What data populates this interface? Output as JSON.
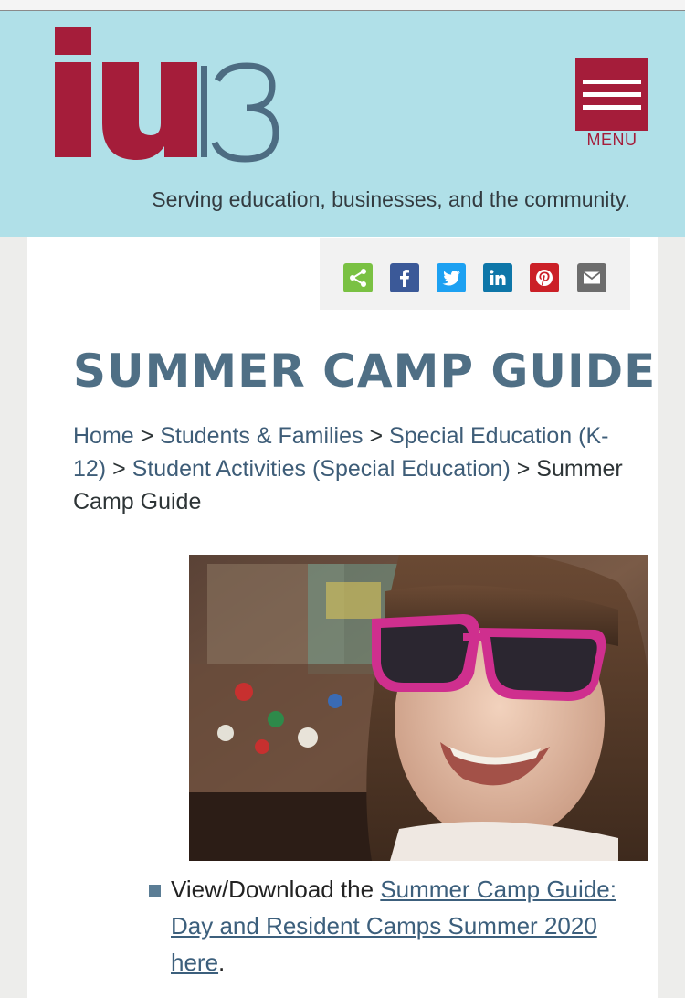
{
  "header": {
    "logo_text": "iu13",
    "menu_label": "MENU",
    "tagline": "Serving education, businesses, and the community.",
    "colors": {
      "background": "#b0e0e8",
      "brand_red": "#a51d3a",
      "brand_slate": "#4d6c82"
    }
  },
  "share": {
    "items": [
      {
        "name": "share",
        "icon": "share-icon",
        "color": "#7ac143"
      },
      {
        "name": "facebook",
        "icon": "facebook-icon",
        "color": "#3b5998"
      },
      {
        "name": "twitter",
        "icon": "twitter-icon",
        "color": "#1da1f2"
      },
      {
        "name": "linkedin",
        "icon": "linkedin-icon",
        "color": "#0e76a8"
      },
      {
        "name": "pinterest",
        "icon": "pinterest-icon",
        "color": "#cb2027"
      },
      {
        "name": "email",
        "icon": "email-icon",
        "color": "#6d6d6d"
      }
    ]
  },
  "page": {
    "title": "SUMMER CAMP GUIDE",
    "breadcrumb": {
      "items": [
        "Home",
        "Students & Families",
        "Special Education (K-12)",
        "Student Activities (Special Education)"
      ],
      "separator": ">",
      "current": "Summer Camp Guide"
    },
    "content": {
      "list_prefix": "View/Download the ",
      "link_text": "Summer Camp Guide: Day and Resident Camps Summer 2020 here",
      "list_suffix": "."
    }
  }
}
